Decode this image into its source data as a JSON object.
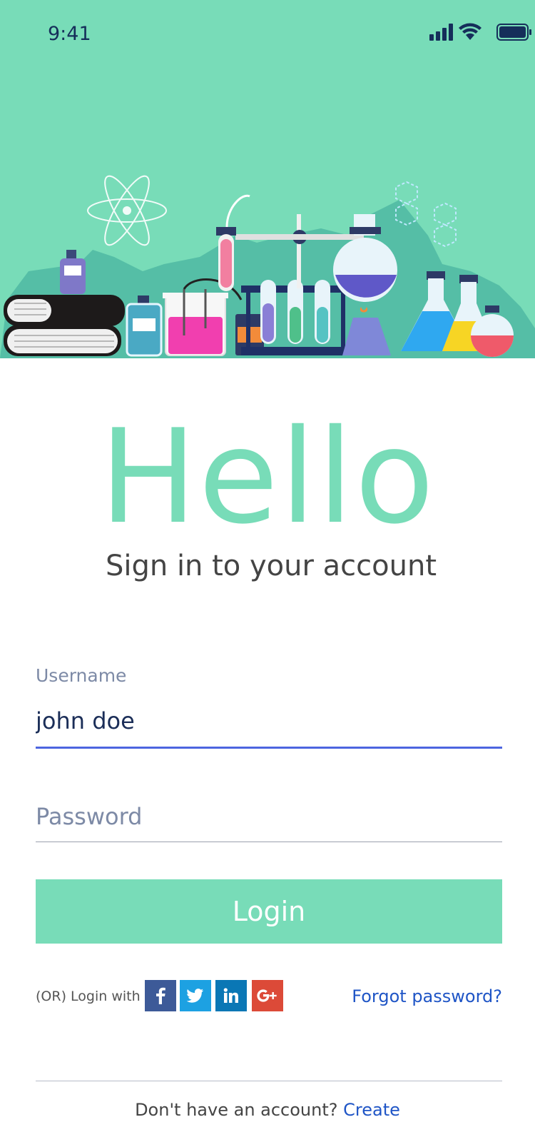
{
  "status_bar": {
    "time": "9:41",
    "icons": [
      "signal-icon",
      "wifi-icon",
      "battery-icon"
    ]
  },
  "hero": {
    "background_color": "#78dcb8",
    "illustration": "laboratory-equipment"
  },
  "greeting": "Hello",
  "subtitle": "Sign in to your account",
  "username": {
    "label": "Username",
    "value": "john doe"
  },
  "password": {
    "placeholder": "Password",
    "value": ""
  },
  "login_button": "Login",
  "social": {
    "label": "(OR) Login with",
    "providers": [
      {
        "name": "facebook",
        "glyph": "f",
        "color": "#3d5a98"
      },
      {
        "name": "twitter",
        "glyph": "twitter-icon",
        "color": "#1da1e2"
      },
      {
        "name": "linkedin",
        "glyph": "in",
        "color": "#0a77b5"
      },
      {
        "name": "google-plus",
        "glyph": "G+",
        "color": "#dc4a38"
      }
    ]
  },
  "forgot_password": "Forgot password?",
  "signup": {
    "prompt": "Don't have an account?",
    "link": "Create"
  },
  "colors": {
    "accent": "#78dcb8",
    "link": "#1f55c6",
    "focus_line": "#4d65e0"
  }
}
